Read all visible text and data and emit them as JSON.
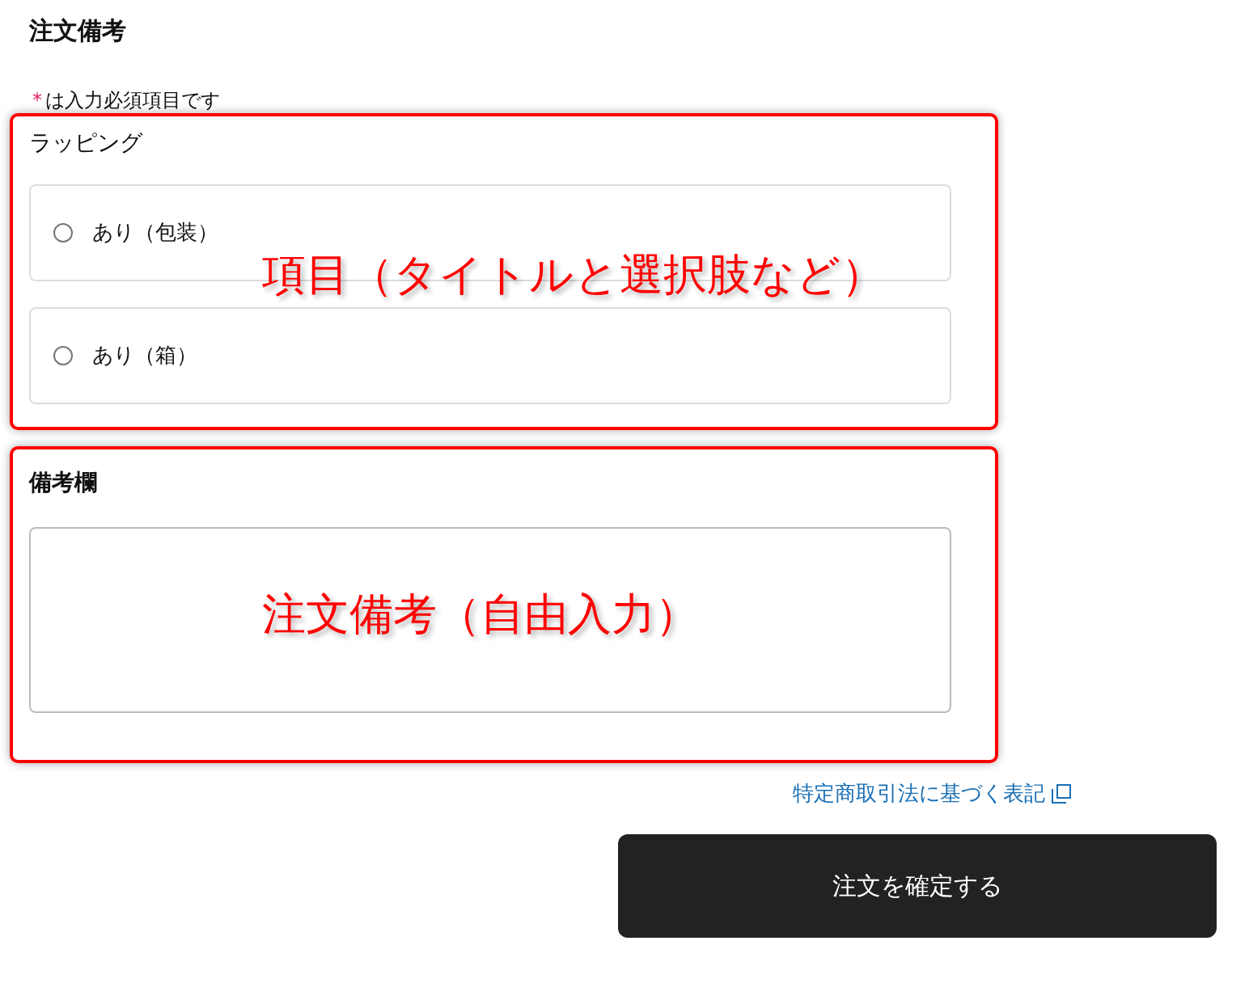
{
  "title": "注文備考",
  "required_note": {
    "mark": "*",
    "text": "は入力必須項目です"
  },
  "wrapping": {
    "label": "ラッピング",
    "annotation": "項目（タイトルと選択肢など）",
    "options": [
      {
        "label": "あり（包装）",
        "selected": false
      },
      {
        "label": "あり（箱）",
        "selected": false
      }
    ]
  },
  "notes": {
    "label": "備考欄",
    "annotation": "注文備考（自由入力）"
  },
  "legal_link": "特定商取引法に基づく表記",
  "confirm_button": "注文を確定する"
}
